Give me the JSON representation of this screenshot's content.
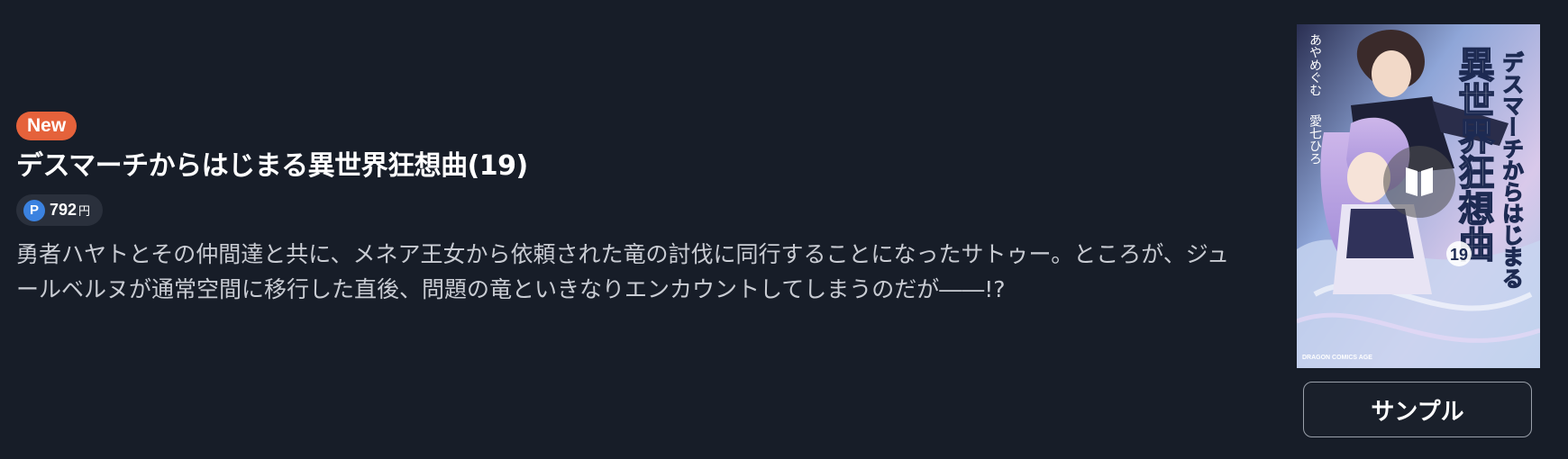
{
  "book": {
    "badge": "New",
    "title": "デスマーチからはじまる異世界狂想曲(19)",
    "price": {
      "icon_letter": "P",
      "value": "792",
      "unit": "円"
    },
    "description": "勇者ハヤトとその仲間達と共に、メネア王女から依頼された竜の討伐に同行することになったサトゥー。ところが、ジュールベルヌが通常空間に移行した直後、問題の竜といきなりエンカウントしてしまうのだが――!?"
  },
  "cover": {
    "title_line1": "デスマーチからはじまる",
    "title_line2": "異世界狂想曲",
    "volume": "19",
    "author": "あやめぐむ",
    "illustrator": "愛七ひろ",
    "label": "DRAGON COMICS AGE",
    "play_icon": "book-open-icon"
  },
  "actions": {
    "sample_label": "サンプル"
  },
  "colors": {
    "background": "#171d28",
    "badge": "#e5623b",
    "point_icon": "#3b82e0"
  }
}
